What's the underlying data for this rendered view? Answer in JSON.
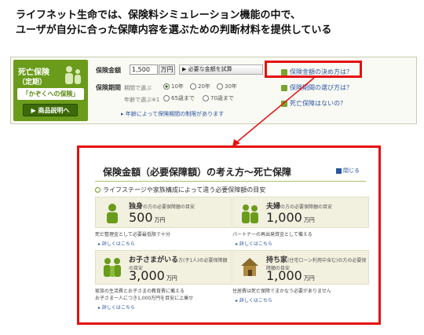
{
  "headline": {
    "line1": "ライフネット生命では、保険料シミュレーション機能の中で、",
    "line2": "ユーザが自分に合った保障内容を選ぶための判断材料を提供している"
  },
  "panel": {
    "brand_title": "死亡保険",
    "brand_sub": "（定期）",
    "brand_tag": "「かぞくへの保険」",
    "brand_button": "▶ 商品説明へ",
    "amount_label": "保険金額",
    "amount_value": "1,500",
    "amount_unit": "万円",
    "trial_button": "▶ 必要な金額を試算",
    "period_label": "保険期間",
    "period_opt1_label": "期間で選ぶ",
    "period_opt1a": "10年",
    "period_opt1b": "20年",
    "period_opt1c": "30年",
    "period_opt2_label": "年齢で選ぶ※1",
    "period_opt2a": "65歳まで",
    "period_opt2b": "70歳まで",
    "period_note": "▸ 年齢によって保険期間の制限があります",
    "link1": "保険金額の決め方は？",
    "link2": "保険期間の選び方は？",
    "link3": "死亡保障はないの？"
  },
  "modal": {
    "title": "保険金額（必要保障額）の考え方〜死亡保障",
    "close": "閉じる",
    "subtitle": "ライフステージや家族構成によって違う必要保障額の目安",
    "cards": [
      {
        "head": "独身",
        "tail": "の方の必要保障額の目安",
        "amount": "500",
        "unit": "万円",
        "desc1": "死亡整理金として必要最低限で十分",
        "desc2": "",
        "more": "▸ 詳しくはこちら"
      },
      {
        "head": "夫婦",
        "tail": "の方の必要保障額の目安",
        "amount": "1,000",
        "unit": "万円",
        "desc1": "パートナーの再出発資金として備える",
        "desc2": "",
        "more": "▸ 詳しくはこちら"
      },
      {
        "head": "お子さまがいる",
        "tail": "方(子1人)の必要保障額の目安",
        "amount": "3,000",
        "unit": "万円",
        "desc1": "家族の生活費とお子さまの教育費に備える",
        "desc2": "お子さま一人につき1,000万円を目安に上乗せ",
        "more": "▸ 詳しくはこちら"
      },
      {
        "head": "持ち家",
        "tail": "(住宅ローン利用中含む)の方の必要保障額の目安",
        "amount": "1,000",
        "unit": "万円",
        "desc1": "住居費は死亡保障でまかなう必要がありません",
        "desc2": "",
        "more": "▸ 詳しくはこちら"
      }
    ]
  },
  "colors": {
    "accent": "#6a9b1a",
    "highlight": "#e41010",
    "link": "#2a55a0"
  }
}
